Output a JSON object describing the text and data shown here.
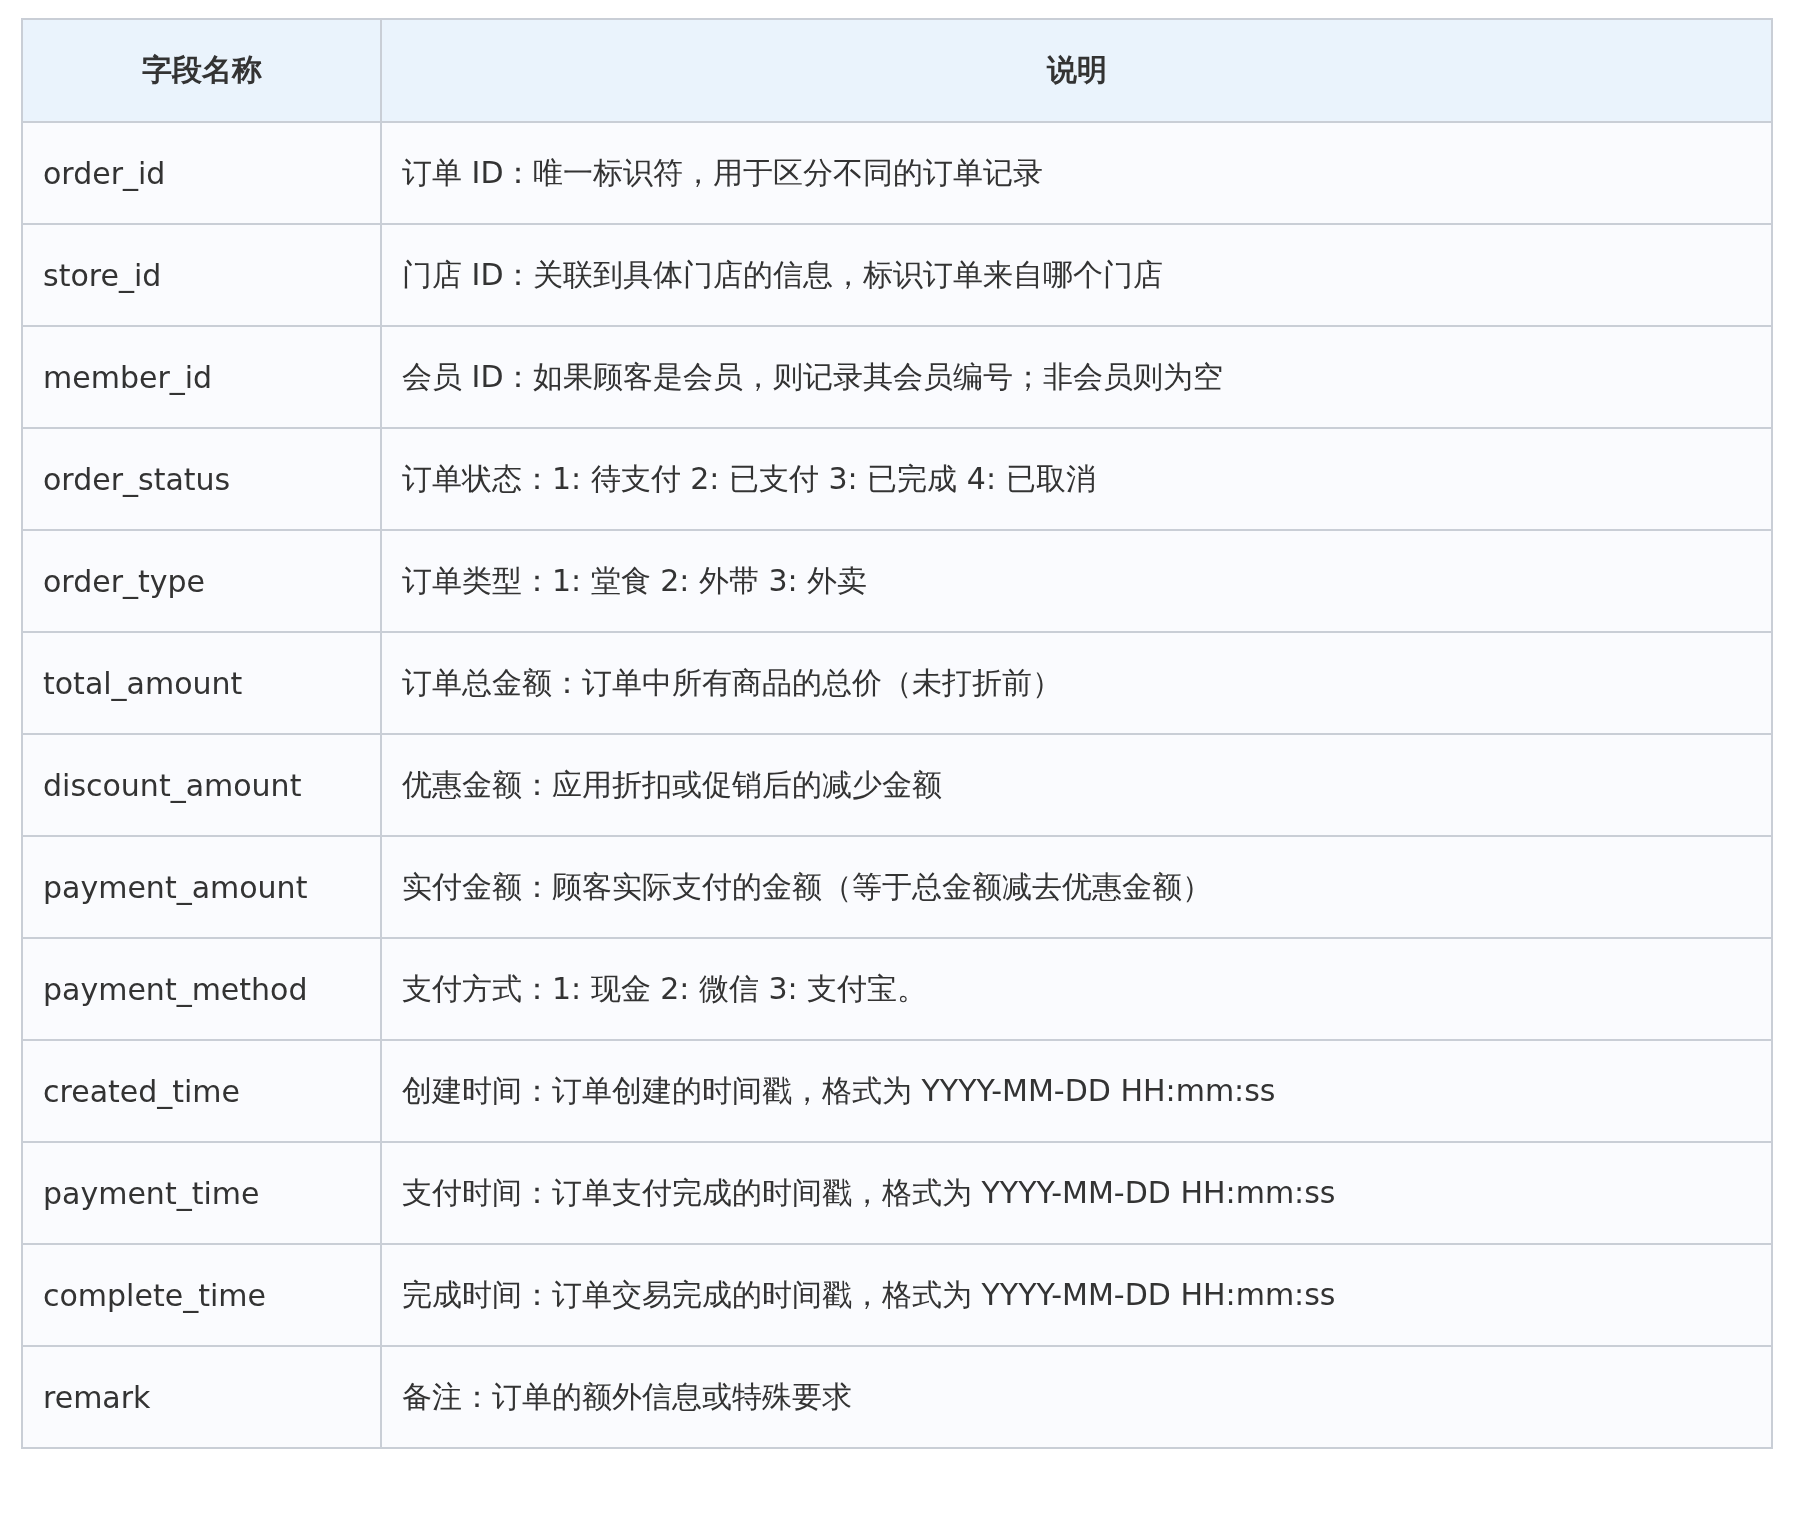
{
  "table": {
    "columns": [
      "字段名称",
      "说明"
    ],
    "rows": [
      {
        "field": "order_id",
        "description": "订单 ID：唯一标识符，用于区分不同的订单记录"
      },
      {
        "field": "store_id",
        "description": "门店 ID：关联到具体门店的信息，标识订单来自哪个门店"
      },
      {
        "field": "member_id",
        "description": "会员 ID：如果顾客是会员，则记录其会员编号；非会员则为空"
      },
      {
        "field": "order_status",
        "description": "订单状态：1: 待支付 2: 已支付 3: 已完成 4: 已取消"
      },
      {
        "field": "order_type",
        "description": "订单类型：1: 堂食 2: 外带 3: 外卖"
      },
      {
        "field": "total_amount",
        "description": "订单总金额：订单中所有商品的总价（未打折前）"
      },
      {
        "field": "discount_amount",
        "description": "优惠金额：应用折扣或促销后的减少金额"
      },
      {
        "field": "payment_amount",
        "description": "实付金额：顾客实际支付的金额（等于总金额减去优惠金额）"
      },
      {
        "field": "payment_method",
        "description": "支付方式：1: 现金 2: 微信 3: 支付宝。"
      },
      {
        "field": "created_time",
        "description": "创建时间：订单创建的时间戳，格式为 YYYY-MM-DD HH:mm:ss"
      },
      {
        "field": "payment_time",
        "description": "支付时间：订单支付完成的时间戳，格式为 YYYY-MM-DD HH:mm:ss"
      },
      {
        "field": "complete_time",
        "description": "完成时间：订单交易完成的时间戳，格式为 YYYY-MM-DD HH:mm:ss"
      },
      {
        "field": "remark",
        "description": "备注：订单的额外信息或特殊要求"
      }
    ]
  }
}
